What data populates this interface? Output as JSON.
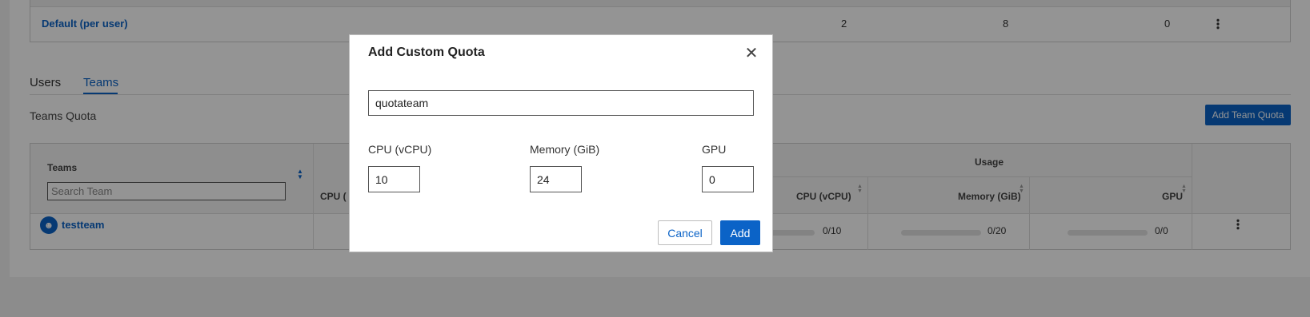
{
  "quota_table": {
    "default_label": "Default (per user)",
    "cpu": "2",
    "memory": "8",
    "gpu": "0"
  },
  "tabs": [
    {
      "label": "Users",
      "active": false
    },
    {
      "label": "Teams",
      "active": true
    }
  ],
  "teams_section": {
    "title": "Teams Quota",
    "add_button_label": "Add Team Quota",
    "table": {
      "teams_header": "Teams",
      "search_placeholder": "Search Team",
      "cpu_partial_header": "CPU (",
      "usage_header": "Usage",
      "usage_columns": [
        "CPU (vCPU)",
        "Memory (GiB)",
        "GPU"
      ],
      "rows": [
        {
          "team": "testteam",
          "cpu_usage": "0/10",
          "memory_usage": "0/20",
          "gpu_usage": "0/0"
        }
      ]
    }
  },
  "modal": {
    "title": "Add Custom Quota",
    "name_value": "quotateam",
    "fields": [
      {
        "label": "CPU (vCPU)",
        "value": "10"
      },
      {
        "label": "Memory (GiB)",
        "value": "24"
      },
      {
        "label": "GPU",
        "value": "0"
      }
    ],
    "cancel_label": "Cancel",
    "add_label": "Add"
  },
  "colors": {
    "accent": "#0b63c7",
    "overlay": "rgba(0,0,0,0.42)"
  },
  "icons": {
    "close": "close-icon",
    "kebab": "kebab-menu-icon",
    "avatar": "user-icon",
    "sort": "sort-icon"
  }
}
